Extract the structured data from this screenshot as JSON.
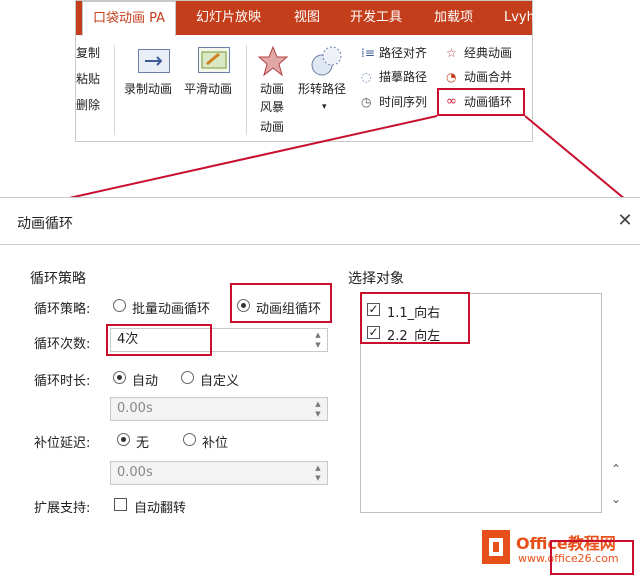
{
  "ribbon": {
    "tabs": [
      "口袋动画 PA",
      "幻灯片放映",
      "视图",
      "开发工具",
      "加载项",
      "Lvyh"
    ],
    "left_items": [
      "复制",
      "粘贴",
      "删除"
    ],
    "record_animation": "录制动画",
    "smooth_animation": "平滑动画",
    "anim_storm": [
      "动画",
      "风暴"
    ],
    "anim_label": "动画",
    "shape_path": "形转路径",
    "path_align": "路径对齐",
    "sketch_path": "描摹路径",
    "timeline": "时间序列",
    "classic_anim": "经典动画",
    "anim_merge": "动画合并",
    "anim_loop": "动画循环"
  },
  "dialog": {
    "title": "动画循环",
    "left_section": "循环策略",
    "strategy_label": "循环策略:",
    "strategy_options": [
      "批量动画循环",
      "动画组循环"
    ],
    "strategy_selected": "动画组循环",
    "count_label": "循环次数:",
    "count_value": "4次",
    "duration_label": "循环时长:",
    "duration_options": [
      "自动",
      "自定义"
    ],
    "duration_selected": "自动",
    "duration_value": "0.00s",
    "delay_label": "补位延迟:",
    "delay_options": [
      "无",
      "补位"
    ],
    "delay_selected": "无",
    "delay_value": "0.00s",
    "ext_label": "扩展支持:",
    "ext_option": "自动翻转",
    "ext_checked": false,
    "right_section": "选择对象",
    "objects": [
      {
        "label": "1.1_向右",
        "checked": true
      },
      {
        "label": "2.2_向左",
        "checked": true
      }
    ]
  },
  "watermark": {
    "brand": "Office教程网",
    "url": "www.office26.com"
  },
  "colors": {
    "ribbon_accent": "#c43e1c",
    "highlight": "#c8102e",
    "watermark_orange": "#e8501a"
  }
}
